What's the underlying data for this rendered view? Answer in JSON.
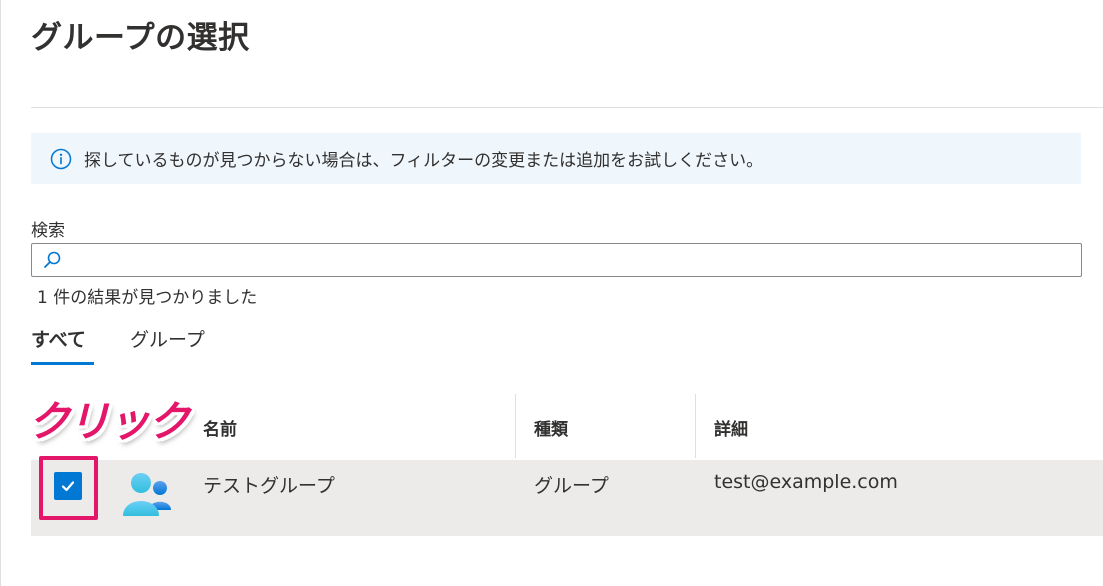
{
  "page": {
    "title": "グループの選択"
  },
  "info": {
    "icon": "info-icon",
    "message": "探しているものが見つからない場合は、フィルターの変更または追加をお試しください。"
  },
  "search": {
    "label": "検索",
    "value": "",
    "placeholder": "",
    "result_count": "1 件の結果が見つかりました"
  },
  "tabs": [
    {
      "label": "すべて",
      "selected": true
    },
    {
      "label": "グループ",
      "selected": false
    }
  ],
  "table": {
    "columns": [
      "名前",
      "種類",
      "詳細"
    ],
    "rows": [
      {
        "name": "テストグループ",
        "type": "グループ",
        "detail": "test@example.com",
        "checked": true,
        "icon": "group-icon"
      }
    ]
  },
  "annotation": {
    "label": "クリック",
    "color": "#e3166a"
  },
  "colors": {
    "accent": "#0078d4",
    "info_background": "#eff6fc",
    "row_selected": "#edebe9"
  }
}
